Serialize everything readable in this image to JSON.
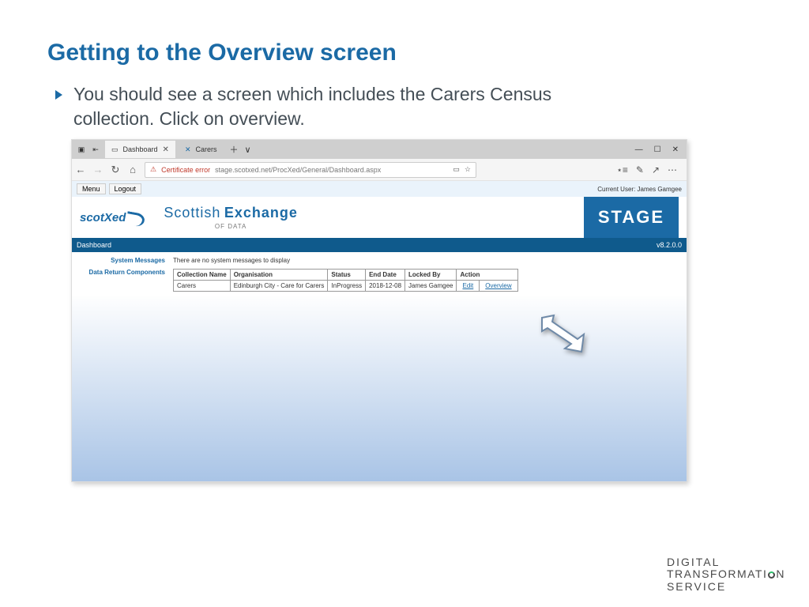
{
  "slide": {
    "title": "Getting to the Overview screen",
    "bullet": "You should see a screen which includes the Carers Census collection. Click on overview."
  },
  "browser": {
    "tab1": "Dashboard",
    "tab2": "Carers",
    "cert_error": "Certificate error",
    "url": "stage.scotxed.net/ProcXed/General/Dashboard.aspx"
  },
  "appbar": {
    "menu": "Menu",
    "logout": "Logout",
    "current_user_label": "Current User:",
    "current_user_name": "James Gamgee"
  },
  "banner": {
    "logo": "scotXed",
    "t1": "Scottish",
    "t2": "Exchange",
    "sub": "OF DATA",
    "stage": "STAGE"
  },
  "bluestrip": {
    "left": "Dashboard",
    "right": "v8.2.0.0"
  },
  "content": {
    "sys_label": "System Messages",
    "sys_text": "There are no system messages to display",
    "drc_label": "Data Return Components",
    "headers": [
      "Collection Name",
      "Organisation",
      "Status",
      "End Date",
      "Locked By",
      "Action"
    ],
    "row": {
      "collection": "Carers",
      "org": "Edinburgh City - Care for Carers",
      "status": "InProgress",
      "end": "2018-12-08",
      "locked": "James Gamgee",
      "edit": "Edit",
      "overview": "Overview"
    }
  },
  "footer": {
    "l1": "DIGITAL",
    "l2a": "TRANSFORMATI",
    "l2b": "N",
    "l3": "SERVICE"
  }
}
